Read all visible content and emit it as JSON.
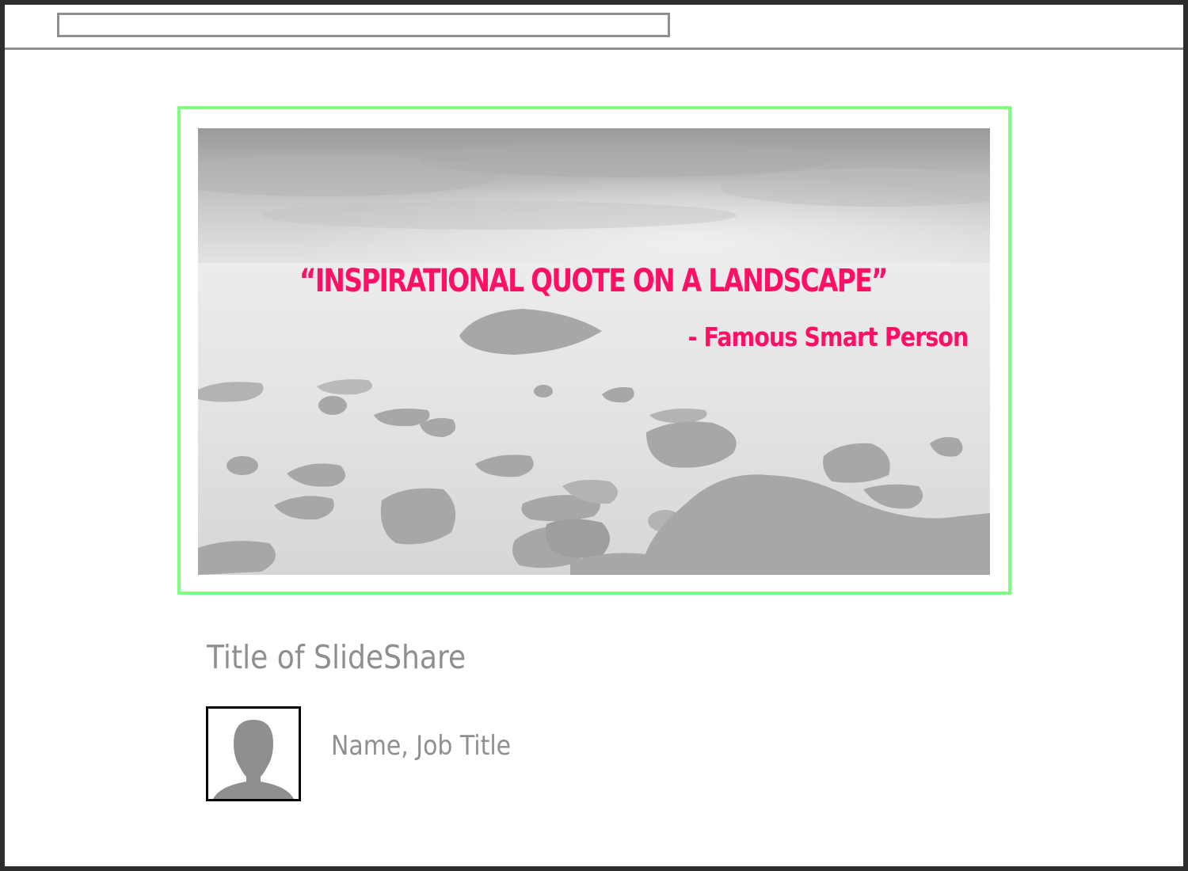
{
  "slide": {
    "quote": "“INSPIRATIONAL QUOTE ON A LANDSCAPE”",
    "author": "- Famous Smart Person"
  },
  "presentation": {
    "title": "Title of SlideShare",
    "author_line": "Name, Job Title"
  },
  "colors": {
    "quote_text": "#ff0f66",
    "slide_frame_border": "#7fff80",
    "muted_text": "#8f8f8f",
    "window_frame": "#2b2d2f"
  },
  "icons": {
    "avatar": "person-silhouette-icon"
  }
}
